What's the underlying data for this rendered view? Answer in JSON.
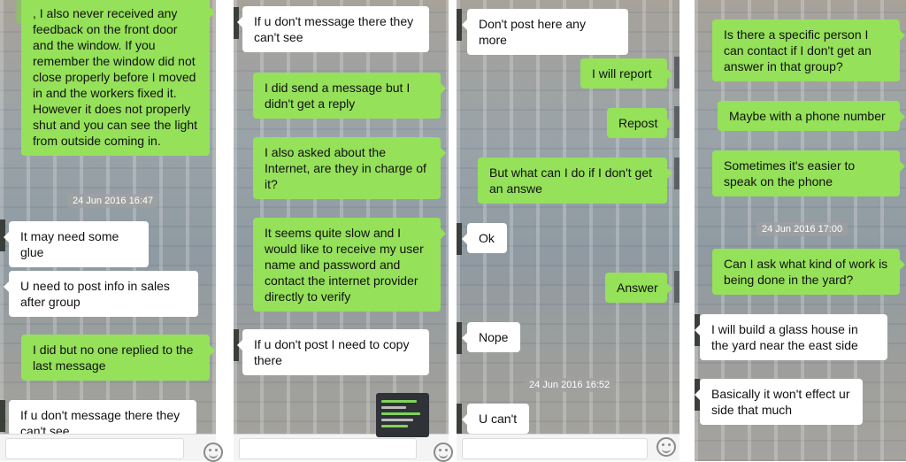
{
  "panels": [
    {
      "messages": [
        {
          "type": "sent",
          "text": ", I also never received any feedback on the front door and the window. If you remember the window did not close properly before I moved in and the workers fixed it. However it does not properly shut and you can see the light from outside coming in."
        },
        {
          "type": "time",
          "text": "24 Jun 2016 16:47"
        },
        {
          "type": "recv",
          "text": "It may need some glue"
        },
        {
          "type": "recv",
          "text": "U need to post info in sales after group"
        },
        {
          "type": "sent",
          "text": "I did but no one replied to the last message"
        },
        {
          "type": "recv",
          "text": "If u don't message there they can't see"
        }
      ]
    },
    {
      "messages": [
        {
          "type": "recv",
          "text": "If u don't message there they can't see"
        },
        {
          "type": "sent",
          "text": "I did send a message but I didn't get a reply"
        },
        {
          "type": "sent",
          "text": "I also asked about the Internet, are they in charge of it?"
        },
        {
          "type": "sent",
          "text": "It seems quite slow and I would like to receive my user name and password and contact the internet provider directly to verify"
        },
        {
          "type": "recv",
          "text": "If u don't post I need to copy there"
        }
      ]
    },
    {
      "messages": [
        {
          "type": "recv",
          "text": "Don't post here any more"
        },
        {
          "type": "sent",
          "text": "I will report"
        },
        {
          "type": "sent",
          "text": "Repost"
        },
        {
          "type": "sent",
          "text": "But what can I do if I don't get an answe"
        },
        {
          "type": "recv",
          "text": "Ok"
        },
        {
          "type": "sent",
          "text": "Answer"
        },
        {
          "type": "recv",
          "text": "Nope"
        },
        {
          "type": "time",
          "text": "24 Jun 2016 16:52"
        },
        {
          "type": "recv",
          "text": "U can't"
        }
      ]
    },
    {
      "messages": [
        {
          "type": "sent",
          "text": "Is there a specific person I can contact if I don't get an answer in that group?"
        },
        {
          "type": "sent",
          "text": "Maybe with a phone number"
        },
        {
          "type": "sent",
          "text": "Sometimes it's easier to speak on the phone"
        },
        {
          "type": "time",
          "text": "24 Jun 2016 17:00"
        },
        {
          "type": "sent",
          "text": "Can I ask what kind of work is being done in the yard?"
        },
        {
          "type": "recv",
          "text": "I will build a glass house in the yard near the east side"
        },
        {
          "type": "recv",
          "text": "Basically it won't effect ur side that much"
        }
      ]
    }
  ],
  "icons": {
    "emoji": "emoji-icon",
    "avatar": "avatar-icon",
    "image": "image-thumbnail-icon"
  },
  "colors": {
    "sent_bubble": "#95e15a",
    "recv_bubble": "#ffffff",
    "time_badge": "#a0a0a0"
  }
}
